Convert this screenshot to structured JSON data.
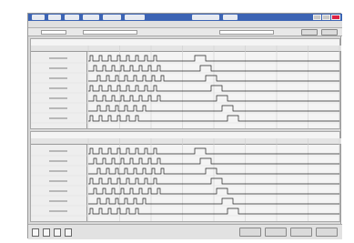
{
  "window": {
    "titlebar_items": [
      "",
      "",
      "",
      "",
      "",
      "",
      "",
      ""
    ],
    "window_buttons": [
      "",
      "",
      ""
    ]
  },
  "menubar": {
    "items": [
      "",
      "",
      "",
      "",
      ""
    ]
  },
  "toolbar": {
    "fields": [
      "",
      "",
      ""
    ],
    "buttons": [
      "",
      ""
    ]
  },
  "panels": [
    {
      "title": "",
      "header_cells": [
        "",
        "",
        "",
        "",
        "",
        "",
        "",
        "",
        ""
      ],
      "row_labels": [
        "",
        "",
        "",
        "",
        "",
        "",
        ""
      ]
    },
    {
      "title": "",
      "header_cells": [
        "",
        "",
        "",
        "",
        "",
        "",
        "",
        "",
        ""
      ],
      "row_labels": [
        "",
        "",
        "",
        "",
        "",
        "",
        ""
      ]
    }
  ],
  "statusbar": {
    "icons": [
      "grid-icon",
      "chart-icon",
      "search-icon",
      "print-icon"
    ],
    "buttons": [
      "",
      "",
      "",
      ""
    ]
  },
  "colors": {
    "titlebar": "#3c64b4",
    "background": "#d8d8d8",
    "panel": "#f4f4f4",
    "trace": "#222222"
  }
}
